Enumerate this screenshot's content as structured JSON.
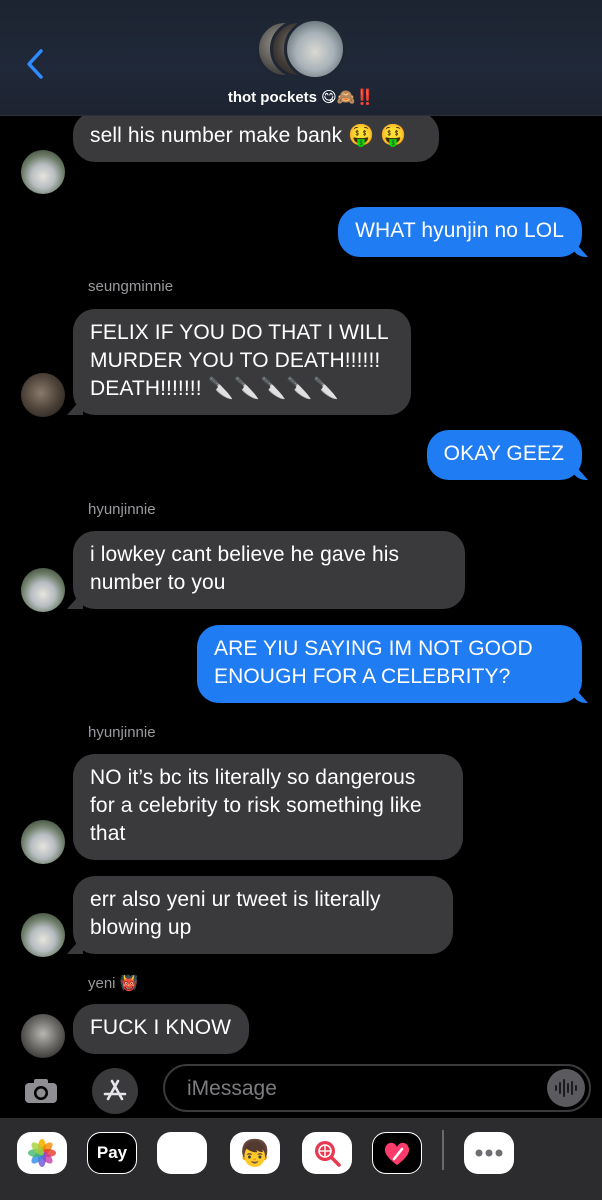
{
  "header": {
    "back_label": "Back",
    "group_name": "thot pockets 😋🙈‼️"
  },
  "messages": [
    {
      "side": "in",
      "sender": "",
      "text": "sell his number make bank 🤑 🤑",
      "avatar": "hyunjinnie-avatar"
    },
    {
      "side": "out",
      "text": "WHAT hyunjin no LOL"
    },
    {
      "side": "in",
      "sender": "seungminnie",
      "text": "FELIX IF YOU DO THAT I WILL MURDER YOU TO DEATH!!!!!! DEATH!!!!!!! 🔪🔪🔪🔪🔪"
    },
    {
      "side": "out",
      "text": "OKAY GEEZ"
    },
    {
      "side": "in",
      "sender": "hyunjinnie",
      "text": "i lowkey cant believe he gave his number to you"
    },
    {
      "side": "out",
      "text": "ARE YIU SAYING IM NOT GOOD ENOUGH FOR A CELEBRITY?"
    },
    {
      "side": "in",
      "sender": "hyunjinnie",
      "text": "NO it’s bc its literally so dangerous for a celebrity to risk something like that"
    },
    {
      "side": "in",
      "sender": "",
      "text": "err also yeni ur tweet is literally blowing up"
    },
    {
      "side": "in",
      "sender": "yeni 👹",
      "text": "FUCK I KNOW"
    }
  ],
  "input": {
    "placeholder": "iMessage"
  },
  "app_drawer": {
    "items": [
      "photos-app",
      "apple-pay",
      "animoji",
      "memoji",
      "image-search",
      "digital-touch",
      "more-apps"
    ],
    "apple_pay_label": "Pay"
  },
  "colors": {
    "outgoing_bubble": "#1f7cf2",
    "incoming_bubble": "#3a3a3c",
    "background": "#000000"
  }
}
